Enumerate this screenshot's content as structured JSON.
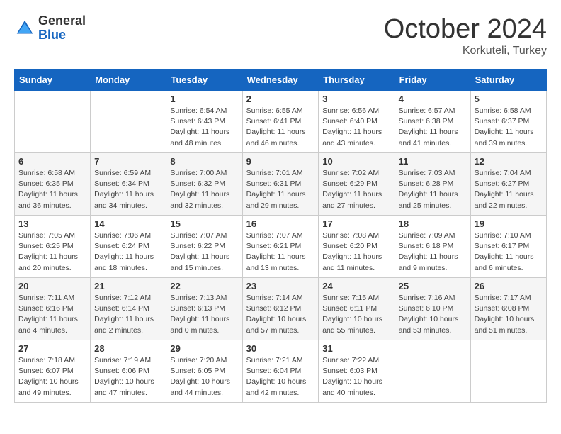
{
  "logo": {
    "general": "General",
    "blue": "Blue"
  },
  "title": "October 2024",
  "location": "Korkuteli, Turkey",
  "weekdays": [
    "Sunday",
    "Monday",
    "Tuesday",
    "Wednesday",
    "Thursday",
    "Friday",
    "Saturday"
  ],
  "weeks": [
    [
      {
        "day": null,
        "info": null
      },
      {
        "day": null,
        "info": null
      },
      {
        "day": "1",
        "info": "Sunrise: 6:54 AM\nSunset: 6:43 PM\nDaylight: 11 hours and 48 minutes."
      },
      {
        "day": "2",
        "info": "Sunrise: 6:55 AM\nSunset: 6:41 PM\nDaylight: 11 hours and 46 minutes."
      },
      {
        "day": "3",
        "info": "Sunrise: 6:56 AM\nSunset: 6:40 PM\nDaylight: 11 hours and 43 minutes."
      },
      {
        "day": "4",
        "info": "Sunrise: 6:57 AM\nSunset: 6:38 PM\nDaylight: 11 hours and 41 minutes."
      },
      {
        "day": "5",
        "info": "Sunrise: 6:58 AM\nSunset: 6:37 PM\nDaylight: 11 hours and 39 minutes."
      }
    ],
    [
      {
        "day": "6",
        "info": "Sunrise: 6:58 AM\nSunset: 6:35 PM\nDaylight: 11 hours and 36 minutes."
      },
      {
        "day": "7",
        "info": "Sunrise: 6:59 AM\nSunset: 6:34 PM\nDaylight: 11 hours and 34 minutes."
      },
      {
        "day": "8",
        "info": "Sunrise: 7:00 AM\nSunset: 6:32 PM\nDaylight: 11 hours and 32 minutes."
      },
      {
        "day": "9",
        "info": "Sunrise: 7:01 AM\nSunset: 6:31 PM\nDaylight: 11 hours and 29 minutes."
      },
      {
        "day": "10",
        "info": "Sunrise: 7:02 AM\nSunset: 6:29 PM\nDaylight: 11 hours and 27 minutes."
      },
      {
        "day": "11",
        "info": "Sunrise: 7:03 AM\nSunset: 6:28 PM\nDaylight: 11 hours and 25 minutes."
      },
      {
        "day": "12",
        "info": "Sunrise: 7:04 AM\nSunset: 6:27 PM\nDaylight: 11 hours and 22 minutes."
      }
    ],
    [
      {
        "day": "13",
        "info": "Sunrise: 7:05 AM\nSunset: 6:25 PM\nDaylight: 11 hours and 20 minutes."
      },
      {
        "day": "14",
        "info": "Sunrise: 7:06 AM\nSunset: 6:24 PM\nDaylight: 11 hours and 18 minutes."
      },
      {
        "day": "15",
        "info": "Sunrise: 7:07 AM\nSunset: 6:22 PM\nDaylight: 11 hours and 15 minutes."
      },
      {
        "day": "16",
        "info": "Sunrise: 7:07 AM\nSunset: 6:21 PM\nDaylight: 11 hours and 13 minutes."
      },
      {
        "day": "17",
        "info": "Sunrise: 7:08 AM\nSunset: 6:20 PM\nDaylight: 11 hours and 11 minutes."
      },
      {
        "day": "18",
        "info": "Sunrise: 7:09 AM\nSunset: 6:18 PM\nDaylight: 11 hours and 9 minutes."
      },
      {
        "day": "19",
        "info": "Sunrise: 7:10 AM\nSunset: 6:17 PM\nDaylight: 11 hours and 6 minutes."
      }
    ],
    [
      {
        "day": "20",
        "info": "Sunrise: 7:11 AM\nSunset: 6:16 PM\nDaylight: 11 hours and 4 minutes."
      },
      {
        "day": "21",
        "info": "Sunrise: 7:12 AM\nSunset: 6:14 PM\nDaylight: 11 hours and 2 minutes."
      },
      {
        "day": "22",
        "info": "Sunrise: 7:13 AM\nSunset: 6:13 PM\nDaylight: 11 hours and 0 minutes."
      },
      {
        "day": "23",
        "info": "Sunrise: 7:14 AM\nSunset: 6:12 PM\nDaylight: 10 hours and 57 minutes."
      },
      {
        "day": "24",
        "info": "Sunrise: 7:15 AM\nSunset: 6:11 PM\nDaylight: 10 hours and 55 minutes."
      },
      {
        "day": "25",
        "info": "Sunrise: 7:16 AM\nSunset: 6:10 PM\nDaylight: 10 hours and 53 minutes."
      },
      {
        "day": "26",
        "info": "Sunrise: 7:17 AM\nSunset: 6:08 PM\nDaylight: 10 hours and 51 minutes."
      }
    ],
    [
      {
        "day": "27",
        "info": "Sunrise: 7:18 AM\nSunset: 6:07 PM\nDaylight: 10 hours and 49 minutes."
      },
      {
        "day": "28",
        "info": "Sunrise: 7:19 AM\nSunset: 6:06 PM\nDaylight: 10 hours and 47 minutes."
      },
      {
        "day": "29",
        "info": "Sunrise: 7:20 AM\nSunset: 6:05 PM\nDaylight: 10 hours and 44 minutes."
      },
      {
        "day": "30",
        "info": "Sunrise: 7:21 AM\nSunset: 6:04 PM\nDaylight: 10 hours and 42 minutes."
      },
      {
        "day": "31",
        "info": "Sunrise: 7:22 AM\nSunset: 6:03 PM\nDaylight: 10 hours and 40 minutes."
      },
      {
        "day": null,
        "info": null
      },
      {
        "day": null,
        "info": null
      }
    ]
  ]
}
